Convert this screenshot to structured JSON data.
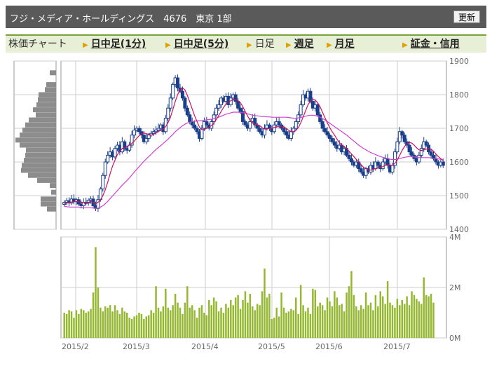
{
  "header": {
    "title": "フジ・メディア・ホールディングス　4676　東京 1部",
    "refresh_label": "更新"
  },
  "tabs": [
    {
      "label": "株価チャート",
      "link": false,
      "arrow": false
    },
    {
      "label": "日中足(1分)",
      "link": true,
      "arrow": true
    },
    {
      "label": "日中足(5分)",
      "link": true,
      "arrow": true
    },
    {
      "label": "日足",
      "link": false,
      "arrow": true
    },
    {
      "label": "週足",
      "link": true,
      "arrow": true
    },
    {
      "label": "月足",
      "link": true,
      "arrow": true
    },
    {
      "label": "証金・信用",
      "link": true,
      "arrow": true
    }
  ],
  "colors": {
    "candle_up": "#ffffff",
    "candle_down": "#1a3f8a",
    "ma_short": "#d01060",
    "ma_long": "#d040d0",
    "volume_bar": "#94b830",
    "volume_profile": "#8c8c8c",
    "grid": "#cccccc",
    "tab_border": "#7aa23a",
    "tab_background": "#e7f0d6"
  },
  "chart_data": [
    {
      "type": "candlestick",
      "ylim": [
        1400,
        1900
      ],
      "y_ticks": [
        1400,
        1500,
        1600,
        1700,
        1800,
        1900
      ],
      "x_ticks": [
        "2015/2",
        "2015/3",
        "2015/4",
        "2015/5",
        "2015/6",
        "2015/7"
      ],
      "grid": true,
      "legend": "none",
      "series": [
        {
          "name": "close",
          "note": "daily close estimates",
          "values": [
            1480,
            1485,
            1478,
            1490,
            1482,
            1488,
            1475,
            1470,
            1480,
            1478,
            1486,
            1490,
            1470,
            1462,
            1488,
            1520,
            1560,
            1600,
            1620,
            1630,
            1615,
            1640,
            1650,
            1630,
            1660,
            1640,
            1635,
            1650,
            1680,
            1695,
            1700,
            1690,
            1680,
            1660,
            1670,
            1680,
            1685,
            1690,
            1695,
            1700,
            1710,
            1690,
            1730,
            1760,
            1790,
            1830,
            1850,
            1820,
            1810,
            1790,
            1760,
            1740,
            1720,
            1710,
            1700,
            1690,
            1670,
            1700,
            1720,
            1710,
            1700,
            1720,
            1740,
            1760,
            1770,
            1790,
            1780,
            1795,
            1770,
            1790,
            1800,
            1780,
            1760,
            1750,
            1720,
            1710,
            1700,
            1720,
            1730,
            1710,
            1700,
            1690,
            1680,
            1700,
            1710,
            1700,
            1690,
            1710,
            1720,
            1710,
            1700,
            1690,
            1680,
            1670,
            1690,
            1700,
            1720,
            1740,
            1770,
            1800,
            1790,
            1810,
            1780,
            1760,
            1770,
            1740,
            1720,
            1700,
            1690,
            1680,
            1670,
            1660,
            1650,
            1640,
            1650,
            1630,
            1640,
            1620,
            1610,
            1600,
            1590,
            1600,
            1580,
            1570,
            1560,
            1580,
            1570,
            1590,
            1580,
            1600,
            1590,
            1580,
            1600,
            1610,
            1590,
            1570,
            1590,
            1630,
            1660,
            1690,
            1680,
            1660,
            1650,
            1630,
            1620,
            1610,
            1600,
            1620,
            1640,
            1660,
            1650,
            1630,
            1620,
            1610,
            1600,
            1590,
            1600,
            1590
          ]
        },
        {
          "name": "moving-average-short",
          "values": [
            1476,
            1478,
            1480,
            1481,
            1482,
            1483,
            1482,
            1480,
            1480,
            1480,
            1480,
            1482,
            1480,
            1477,
            1480,
            1488,
            1500,
            1518,
            1540,
            1565,
            1588,
            1605,
            1622,
            1632,
            1640,
            1643,
            1646,
            1650,
            1655,
            1662,
            1670,
            1678,
            1684,
            1686,
            1684,
            1682,
            1680,
            1682,
            1686,
            1690,
            1695,
            1697,
            1705,
            1717,
            1733,
            1756,
            1780,
            1800,
            1815,
            1820,
            1814,
            1798,
            1778,
            1758,
            1738,
            1720,
            1704,
            1696,
            1696,
            1700,
            1704,
            1708,
            1716,
            1726,
            1738,
            1750,
            1762,
            1772,
            1778,
            1782,
            1786,
            1786,
            1782,
            1776,
            1764,
            1750,
            1736,
            1724,
            1716,
            1712,
            1710,
            1708,
            1702,
            1698,
            1698,
            1700,
            1700,
            1702,
            1704,
            1706,
            1706,
            1704,
            1700,
            1694,
            1690,
            1690,
            1694,
            1702,
            1716,
            1734,
            1752,
            1770,
            1782,
            1786,
            1784,
            1776,
            1764,
            1748,
            1732,
            1716,
            1702,
            1690,
            1680,
            1668,
            1658,
            1650,
            1646,
            1640,
            1632,
            1624,
            1616,
            1608,
            1600,
            1592,
            1584,
            1580,
            1576,
            1576,
            1578,
            1580,
            1582,
            1584,
            1586,
            1590,
            1592,
            1590,
            1590,
            1596,
            1606,
            1620,
            1634,
            1646,
            1654,
            1658,
            1656,
            1650,
            1642,
            1636,
            1634,
            1636,
            1638,
            1640,
            1638,
            1632,
            1624,
            1616,
            1610,
            1604
          ]
        },
        {
          "name": "moving-average-long",
          "values": [
            1468,
            1467,
            1466,
            1466,
            1466,
            1466,
            1466,
            1465,
            1464,
            1464,
            1464,
            1464,
            1463,
            1462,
            1463,
            1466,
            1470,
            1476,
            1483,
            1491,
            1499,
            1507,
            1515,
            1523,
            1531,
            1538,
            1545,
            1553,
            1561,
            1570,
            1578,
            1586,
            1594,
            1602,
            1609,
            1616,
            1623,
            1630,
            1637,
            1643,
            1649,
            1655,
            1661,
            1668,
            1675,
            1682,
            1690,
            1696,
            1702,
            1708,
            1712,
            1716,
            1718,
            1720,
            1721,
            1722,
            1722,
            1723,
            1724,
            1725,
            1726,
            1727,
            1729,
            1731,
            1733,
            1736,
            1739,
            1742,
            1744,
            1746,
            1748,
            1748,
            1748,
            1747,
            1746,
            1745,
            1743,
            1741,
            1739,
            1738,
            1737,
            1736,
            1735,
            1735,
            1734,
            1734,
            1733,
            1733,
            1733,
            1733,
            1733,
            1733,
            1733,
            1732,
            1731,
            1730,
            1730,
            1731,
            1732,
            1734,
            1736,
            1738,
            1739,
            1739,
            1738,
            1736,
            1733,
            1729,
            1725,
            1720,
            1715,
            1710,
            1705,
            1700,
            1695,
            1690,
            1685,
            1680,
            1674,
            1668,
            1662,
            1656,
            1650,
            1645,
            1640,
            1636,
            1632,
            1628,
            1625,
            1622,
            1619,
            1616,
            1614,
            1612,
            1610,
            1608,
            1607,
            1607,
            1608,
            1610,
            1612,
            1614,
            1615,
            1616,
            1616,
            1615,
            1614,
            1613,
            1613,
            1613,
            1613,
            1613,
            1612,
            1611,
            1610,
            1609,
            1608,
            1607
          ]
        }
      ],
      "volume_profile": [
        {
          "price": 1865,
          "size": 9
        },
        {
          "price": 1830,
          "size": 14
        },
        {
          "price": 1815,
          "size": 16
        },
        {
          "price": 1800,
          "size": 25
        },
        {
          "price": 1785,
          "size": 26
        },
        {
          "price": 1770,
          "size": 28
        },
        {
          "price": 1755,
          "size": 33
        },
        {
          "price": 1740,
          "size": 29
        },
        {
          "price": 1725,
          "size": 39
        },
        {
          "price": 1710,
          "size": 44
        },
        {
          "price": 1695,
          "size": 48
        },
        {
          "price": 1680,
          "size": 52
        },
        {
          "price": 1665,
          "size": 58
        },
        {
          "price": 1650,
          "size": 52
        },
        {
          "price": 1635,
          "size": 43
        },
        {
          "price": 1620,
          "size": 44
        },
        {
          "price": 1605,
          "size": 46
        },
        {
          "price": 1590,
          "size": 49
        },
        {
          "price": 1575,
          "size": 50
        },
        {
          "price": 1560,
          "size": 40
        },
        {
          "price": 1545,
          "size": 27
        },
        {
          "price": 1530,
          "size": 9
        },
        {
          "price": 1510,
          "size": 7
        },
        {
          "price": 1490,
          "size": 22
        },
        {
          "price": 1475,
          "size": 22
        },
        {
          "price": 1460,
          "size": 13
        }
      ]
    },
    {
      "type": "bar",
      "name": "volume",
      "ylim": [
        0,
        4000000
      ],
      "y_tick_labels": [
        "4M",
        "2M",
        "0M"
      ],
      "x_ticks": [
        "2015/2",
        "2015/3",
        "2015/4",
        "2015/5",
        "2015/6",
        "2015/7"
      ],
      "grid": true,
      "values": [
        1000000,
        950000,
        1100000,
        1050000,
        800000,
        1100000,
        950000,
        1150000,
        1100000,
        1000000,
        1050000,
        1150000,
        1800000,
        3600000,
        2000000,
        1200000,
        1050000,
        1250000,
        1200000,
        1300000,
        1050000,
        1300000,
        1100000,
        950000,
        1200000,
        1050000,
        1000000,
        800000,
        750000,
        850000,
        900000,
        1000000,
        950000,
        750000,
        850000,
        900000,
        1100000,
        1000000,
        2050000,
        1200000,
        1050000,
        1250000,
        1950000,
        1200000,
        1100000,
        1300000,
        1750000,
        1400000,
        1200000,
        950000,
        1400000,
        2050000,
        1200000,
        1300000,
        1100000,
        800000,
        1200000,
        1300000,
        1000000,
        900000,
        1500000,
        1300000,
        1600000,
        1450000,
        1050000,
        1200000,
        1000000,
        1350000,
        1200000,
        1500000,
        1300000,
        1600000,
        1700000,
        1150000,
        1500000,
        1850000,
        1400000,
        1750000,
        1250000,
        1100000,
        1350000,
        1300000,
        1850000,
        2750000,
        1600000,
        1750000,
        750000,
        800000,
        1200000,
        850000,
        1800000,
        1200000,
        1000000,
        1050000,
        1150000,
        1100000,
        1600000,
        950000,
        2100000,
        1300000,
        1050000,
        1200000,
        950000,
        1950000,
        1900000,
        1250000,
        1400000,
        1300000,
        1100000,
        1600000,
        1450000,
        1250000,
        1850000,
        1600000,
        1300000,
        1350000,
        1050000,
        1800000,
        2050000,
        2650000,
        1700000,
        1250000,
        1100000,
        1300000,
        1150000,
        1800000,
        1300000,
        1400000,
        1100000,
        1700000,
        1250000,
        1850000,
        1650000,
        1350000,
        2250000,
        1400000,
        1300000,
        1200000,
        1550000,
        1300000,
        1500000,
        1350000,
        1650000,
        1300000,
        1850000,
        1700000,
        1550000,
        1450000,
        1350000,
        2400000,
        1700000,
        1650000,
        1750000,
        1400000
      ]
    }
  ]
}
